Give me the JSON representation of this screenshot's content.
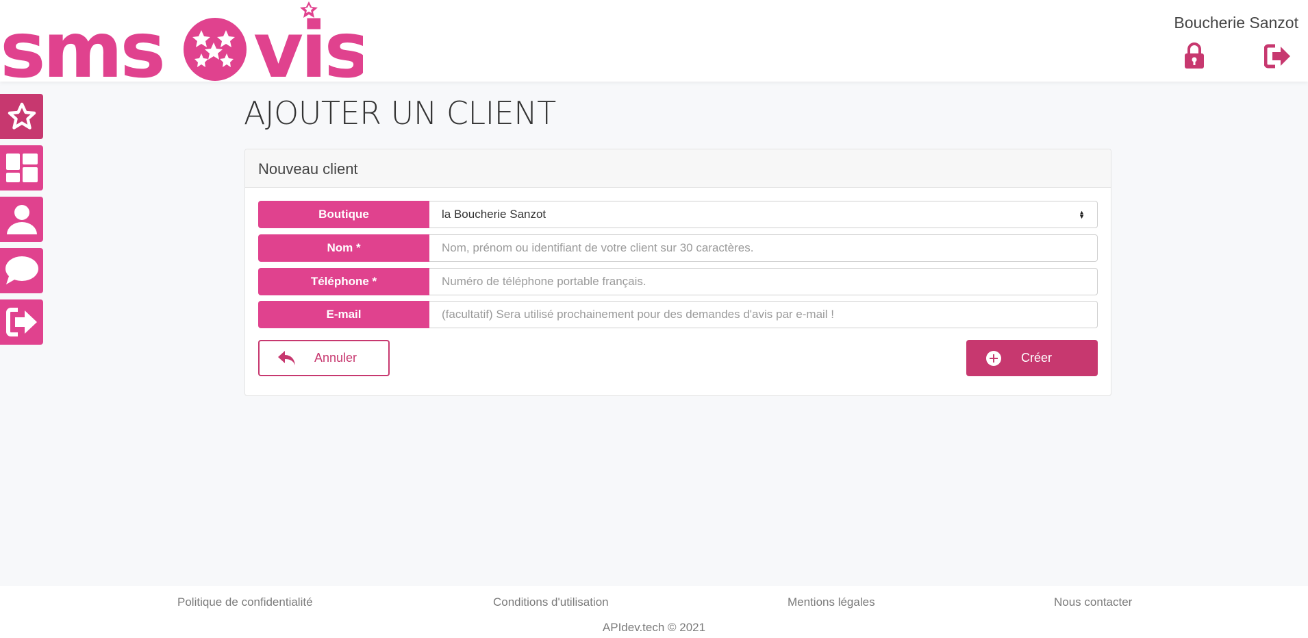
{
  "header": {
    "logo_text": "smsavis",
    "account_name": "Boucherie Sanzot",
    "lock_icon": "lock-icon",
    "logout_icon": "logout-icon",
    "brand_color": "#e0428e",
    "brand_dark": "#c7386f"
  },
  "sidebar": {
    "items": [
      {
        "icon": "star-icon",
        "name": "avis"
      },
      {
        "icon": "dashboard-icon",
        "name": "dashboard"
      },
      {
        "icon": "user-icon",
        "name": "clients"
      },
      {
        "icon": "chat-icon",
        "name": "messages"
      },
      {
        "icon": "logout-icon",
        "name": "logout"
      }
    ]
  },
  "main": {
    "title": "AJOUTER UN CLIENT",
    "card_title": "Nouveau client",
    "fields": {
      "boutique": {
        "label": "Boutique",
        "value": "la Boucherie Sanzot"
      },
      "nom": {
        "label": "Nom *",
        "placeholder": "Nom, prénom ou identifiant de votre client sur 30 caractères."
      },
      "telephone": {
        "label": "Téléphone *",
        "placeholder": "Numéro de téléphone portable français."
      },
      "email": {
        "label": "E-mail",
        "placeholder": "(facultatif) Sera utilisé prochainement pour des demandes d'avis par e-mail !"
      }
    },
    "cancel_label": "Annuler",
    "create_label": "Créer"
  },
  "footer": {
    "links": [
      "Politique de confidentialité",
      "Conditions d'utilisation",
      "Mentions légales",
      "Nous contacter"
    ],
    "copyright": "APIdev.tech © 2021"
  }
}
